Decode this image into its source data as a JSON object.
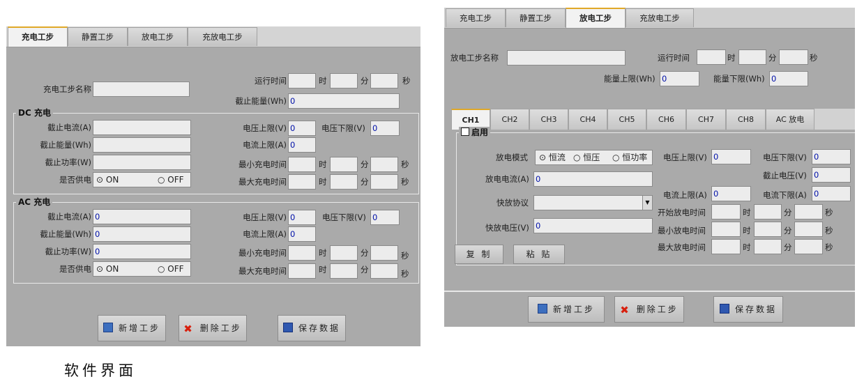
{
  "caption": "软件界面",
  "left": {
    "tabs": [
      "充电工步",
      "静置工步",
      "放电工步",
      "充放电工步"
    ],
    "step_name_label": "充电工步名称",
    "run_time_label": "运行时间",
    "unit_h": "时",
    "unit_m": "分",
    "unit_s": "秒",
    "cutoff_energy_label": "截止能量(Wh)",
    "cutoff_energy_value": "0",
    "dc": {
      "title": "DC 充电",
      "cutoff_current": "截止电流(A)",
      "cutoff_energy": "截止能量(Wh)",
      "cutoff_power": "截止功率(W)",
      "supply": "是否供电",
      "on": "⊙ ON",
      "off": "○ OFF",
      "v_upper": "电压上限(V)",
      "v_upper_value": "0",
      "v_lower": "电压下限(V)",
      "v_lower_value": "0",
      "i_upper": "电流上限(A)",
      "i_upper_value": "0",
      "min_time": "最小充电时间",
      "max_time": "最大充电时间"
    },
    "ac": {
      "title": "AC 充电",
      "cutoff_current": "截止电流(A)",
      "cutoff_current_value": "0",
      "cutoff_energy": "截止能量(Wh)",
      "cutoff_energy_value": "0",
      "cutoff_power": "截止功率(W)",
      "cutoff_power_value": "0",
      "supply": "是否供电",
      "on": "⊙ ON",
      "off": "○ OFF",
      "v_upper": "电压上限(V)",
      "v_upper_value": "0",
      "v_lower": "电压下限(V)",
      "v_lower_value": "0",
      "i_upper": "电流上限(A)",
      "i_upper_value": "0",
      "min_time": "最小充电时间",
      "max_time": "最大充电时间"
    },
    "buttons": {
      "add": "新增工步",
      "delete": "删除工步",
      "save": "保存数据"
    }
  },
  "right": {
    "tabs": [
      "充电工步",
      "静置工步",
      "放电工步",
      "充放电工步"
    ],
    "step_name_label": "放电工步名称",
    "run_time_label": "运行时间",
    "unit_h": "时",
    "unit_m": "分",
    "unit_s": "秒",
    "energy_upper_label": "能量上限(Wh)",
    "energy_upper_value": "0",
    "energy_lower_label": "能量下限(Wh)",
    "energy_lower_value": "0",
    "channels": [
      "CH1",
      "CH2",
      "CH3",
      "CH4",
      "CH5",
      "CH6",
      "CH7",
      "CH8",
      "AC 放电"
    ],
    "enable_label": "启用",
    "mode_label": "放电模式",
    "mode_options": [
      "⊙ 恒流",
      "○ 恒压",
      "○ 恒功率"
    ],
    "current_label": "放电电流(A)",
    "current_value": "0",
    "fast_protocol_label": "快放协议",
    "fast_voltage_label": "快放电压(V)",
    "fast_voltage_value": "0",
    "v_upper": "电压上限(V)",
    "v_upper_value": "0",
    "v_lower": "电压下限(V)",
    "v_lower_value": "0",
    "cutoff_voltage": "截止电压(V)",
    "cutoff_voltage_value": "0",
    "i_upper": "电流上限(A)",
    "i_upper_value": "0",
    "i_lower": "电流下限(A)",
    "i_lower_value": "0",
    "start_time": "开始放电时间",
    "min_time": "最小放电时间",
    "max_time": "最大放电时间",
    "copy": "复 制",
    "paste": "粘 贴",
    "buttons": {
      "add": "新增工步",
      "delete": "删除工步",
      "save": "保存数据"
    }
  }
}
